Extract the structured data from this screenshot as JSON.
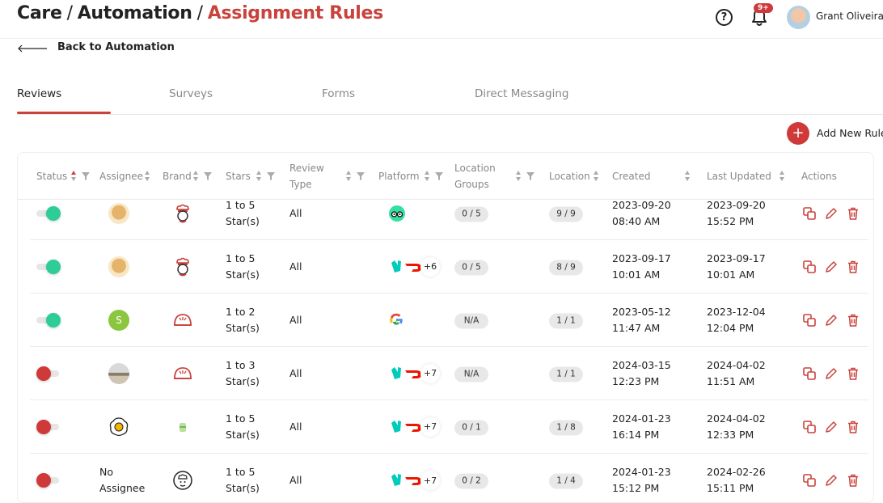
{
  "header": {
    "breadcrumb": [
      "Care",
      "Automation",
      "Assignment Rules"
    ],
    "separator": "/",
    "help_label": "?",
    "notifications_badge": "9+",
    "user_name": "Grant Oliveira"
  },
  "back_label": "Back to Automation",
  "tabs": [
    "Reviews",
    "Surveys",
    "Forms",
    "Direct Messaging"
  ],
  "active_tab": "Reviews",
  "add_rule_label": "Add New Rule",
  "add_rule_icon": "+",
  "columns": {
    "status": "Status",
    "assignee": "Assignee",
    "brand": "Brand",
    "stars": "Stars",
    "review_type_1": "Review",
    "review_type_2": "Type",
    "platform": "Platform",
    "location_groups_1": "Location",
    "location_groups_2": "Groups",
    "location": "Location",
    "created": "Created",
    "last_updated": "Last Updated",
    "actions": "Actions"
  },
  "rows": [
    {
      "status": "on",
      "assignee": "doge-avatar",
      "brand": "chef-logo",
      "stars_1": "1 to 5",
      "stars_2": "Star(s)",
      "review_type": "All",
      "platforms": [
        "tripadvisor"
      ],
      "more": "",
      "location_groups": "0 / 5",
      "location": "9 / 9",
      "created_date": "2023-09-20",
      "created_time": "08:40 AM",
      "updated_date": "2023-09-20",
      "updated_time": "15:52 PM"
    },
    {
      "status": "on",
      "assignee": "doge-avatar",
      "brand": "chef-logo",
      "stars_1": "1 to 5",
      "stars_2": "Star(s)",
      "review_type": "All",
      "platforms": [
        "deliveroo",
        "doordash"
      ],
      "more": "+6",
      "location_groups": "0 / 5",
      "location": "8 / 9",
      "created_date": "2023-09-17",
      "created_time": "10:01 AM",
      "updated_date": "2023-09-17",
      "updated_time": "10:01 AM"
    },
    {
      "status": "on",
      "assignee": "initial-avatar",
      "assignee_initial": "S",
      "brand": "dome-logo",
      "stars_1": "1 to 2",
      "stars_2": "Star(s)",
      "review_type": "All",
      "platforms": [
        "google"
      ],
      "more": "",
      "location_groups": "N/A",
      "location": "1 / 1",
      "created_date": "2023-05-12",
      "created_time": "11:47 AM",
      "updated_date": "2023-12-04",
      "updated_time": "12:04 PM"
    },
    {
      "status": "off",
      "assignee": "photo-avatar",
      "brand": "dome-logo",
      "stars_1": "1 to 3",
      "stars_2": "Star(s)",
      "review_type": "All",
      "platforms": [
        "deliveroo",
        "doordash"
      ],
      "more": "+7",
      "location_groups": "N/A",
      "location": "1 / 1",
      "created_date": "2024-03-15",
      "created_time": "12:23 PM",
      "updated_date": "2024-04-02",
      "updated_time": "11:51 AM"
    },
    {
      "status": "off",
      "assignee": "egg-avatar",
      "brand": "jar-logo",
      "stars_1": "1 to 5",
      "stars_2": "Star(s)",
      "review_type": "All",
      "platforms": [
        "deliveroo",
        "doordash"
      ],
      "more": "+7",
      "location_groups": "0 / 1",
      "location": "1 / 8",
      "created_date": "2024-01-23",
      "created_time": "16:14 PM",
      "updated_date": "2024-04-02",
      "updated_time": "12:33 PM"
    },
    {
      "status": "off",
      "assignee": "none",
      "assignee_text_1": "No",
      "assignee_text_2": "Assignee",
      "brand": "chef-outline-logo",
      "stars_1": "1 to 5",
      "stars_2": "Star(s)",
      "review_type": "All",
      "platforms": [
        "deliveroo",
        "doordash"
      ],
      "more": "+7",
      "location_groups": "0 / 2",
      "location": "1 / 4",
      "created_date": "2024-01-23",
      "created_time": "15:12 PM",
      "updated_date": "2024-02-26",
      "updated_time": "15:11 PM"
    }
  ],
  "colors": {
    "accent": "#c9423c",
    "toggle_on": "#2ecc96",
    "toggle_off": "#d0393a",
    "pill_bg": "#e8e8e8"
  },
  "icons": {
    "back": "arrow-left-icon",
    "help": "help-circle-icon",
    "notifications": "bell-icon",
    "copy": "copy-icon",
    "edit": "pencil-icon",
    "delete": "trash-icon",
    "sort": "sort-arrows-icon",
    "filter": "funnel-icon"
  }
}
